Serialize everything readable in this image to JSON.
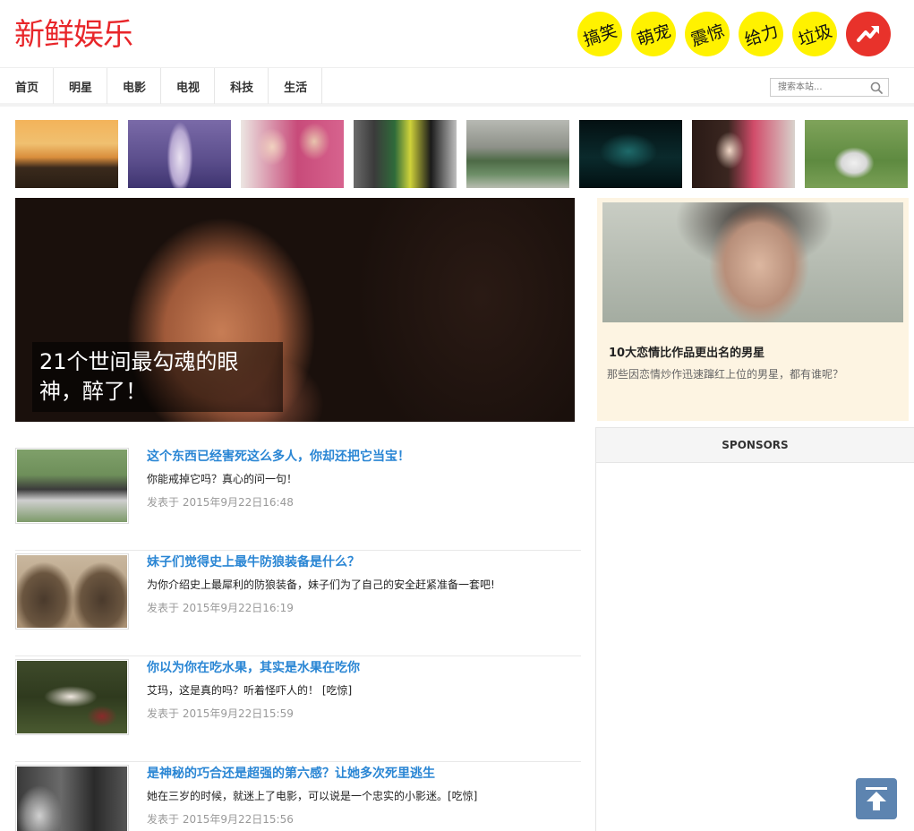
{
  "site": {
    "logo": "新鲜娱乐",
    "brand_color": "#e8262a"
  },
  "tags": [
    {
      "label": "搞笑"
    },
    {
      "label": "萌宠"
    },
    {
      "label": "震惊"
    },
    {
      "label": "给力"
    },
    {
      "label": "垃圾"
    }
  ],
  "trend_icon": "trending-up-icon",
  "nav": {
    "items": [
      "首页",
      "明星",
      "电影",
      "电视",
      "科技",
      "生活"
    ]
  },
  "search": {
    "placeholder": "搜索本站..."
  },
  "featured": {
    "title": "21个世间最勾魂的眼神，醉了！"
  },
  "side": {
    "title": "10大恋情比作品更出名的男星",
    "desc": "那些因恋情炒作迅速蹿红上位的男星，都有谁呢？"
  },
  "sponsors": {
    "heading": "SPONSORS"
  },
  "articles": [
    {
      "title": "这个东西已经害死这么多人，你却还把它当宝！",
      "desc": "你能戒掉它吗？真心的问一句！",
      "date": "发表于 2015年9月22日16:48"
    },
    {
      "title": "妹子们觉得史上最牛防狼装备是什么？",
      "desc": "为你介绍史上最犀利的防狼装备，妹子们为了自己的安全赶紧准备一套吧!",
      "date": "发表于 2015年9月22日16:19"
    },
    {
      "title": "你以为你在吃水果，其实是水果在吃你",
      "desc": "艾玛，这是真的吗？听着怪吓人的！ [吃惊]",
      "date": "发表于 2015年9月22日15:59"
    },
    {
      "title": "是神秘的巧合还是超强的第六感？让她多次死里逃生",
      "desc": "她在三岁的时候，就迷上了电影，可以说是一个忠实的小影迷。[吃惊]",
      "date": "发表于 2015年9月22日15:56"
    }
  ]
}
